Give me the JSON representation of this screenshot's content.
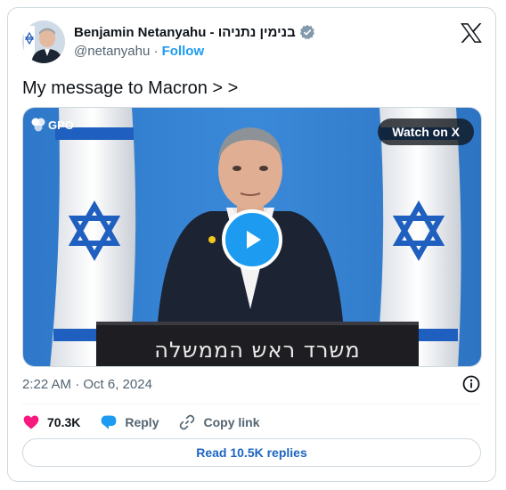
{
  "author": {
    "display_name": "Benjamin Netanyahu - בנימין נתניהו",
    "handle": "@netanyahu",
    "separator": "·",
    "follow_label": "Follow"
  },
  "tweet": {
    "text": "My message to Macron > >",
    "timestamp": "2:22 AM · Oct 6, 2024"
  },
  "media": {
    "watermark": "GPO",
    "watch_label": "Watch on X",
    "podium_text": "משרד ראש הממשלה"
  },
  "actions": {
    "like_count": "70.3K",
    "reply_label": "Reply",
    "copy_label": "Copy link"
  },
  "read_replies_label": "Read 10.5K replies",
  "colors": {
    "accent": "#1d9bf0",
    "like": "#f91880",
    "text": "#0f1419",
    "muted": "#536471",
    "border": "#cfd9de"
  }
}
